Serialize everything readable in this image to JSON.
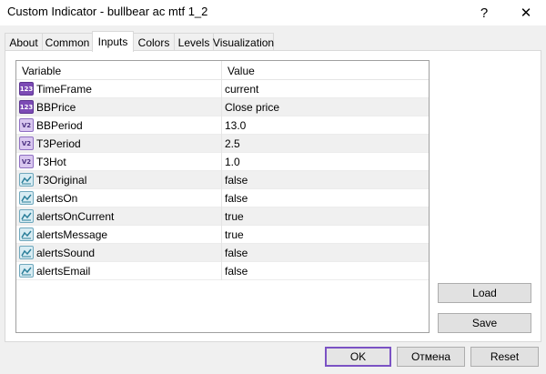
{
  "window": {
    "title": "Custom Indicator - bullbear ac mtf 1_2",
    "help_glyph": "?",
    "close_glyph": "✕"
  },
  "tabs": [
    {
      "label": "About"
    },
    {
      "label": "Common"
    },
    {
      "label": "Inputs",
      "active": true
    },
    {
      "label": "Colors"
    },
    {
      "label": "Levels"
    },
    {
      "label": "Visualization"
    }
  ],
  "grid": {
    "headers": {
      "variable": "Variable",
      "value": "Value"
    },
    "rows": [
      {
        "type": "int-icon",
        "icon_text": "123",
        "name": "TimeFrame",
        "value": "current"
      },
      {
        "type": "int-icon",
        "icon_text": "123",
        "name": "BBPrice",
        "value": "Close price"
      },
      {
        "type": "double-icon",
        "icon_text": "V2",
        "name": "BBPeriod",
        "value": "13.0"
      },
      {
        "type": "double-icon",
        "icon_text": "V2",
        "name": "T3Period",
        "value": "2.5"
      },
      {
        "type": "double-icon",
        "icon_text": "V2",
        "name": "T3Hot",
        "value": "1.0"
      },
      {
        "type": "bool-icon",
        "icon_text": "",
        "name": "T3Original",
        "value": "false"
      },
      {
        "type": "bool-icon",
        "icon_text": "",
        "name": "alertsOn",
        "value": "false"
      },
      {
        "type": "bool-icon",
        "icon_text": "",
        "name": "alertsOnCurrent",
        "value": "true"
      },
      {
        "type": "bool-icon",
        "icon_text": "",
        "name": "alertsMessage",
        "value": "true"
      },
      {
        "type": "bool-icon",
        "icon_text": "",
        "name": "alertsSound",
        "value": "false"
      },
      {
        "type": "bool-icon",
        "icon_text": "",
        "name": "alertsEmail",
        "value": "false"
      }
    ]
  },
  "side_buttons": {
    "load": "Load",
    "save": "Save"
  },
  "footer_buttons": {
    "ok": "OK",
    "cancel": "Отмена",
    "reset": "Reset"
  },
  "colors": {
    "accent": "#7b52c4",
    "alt_row": "#f0f0f0"
  }
}
